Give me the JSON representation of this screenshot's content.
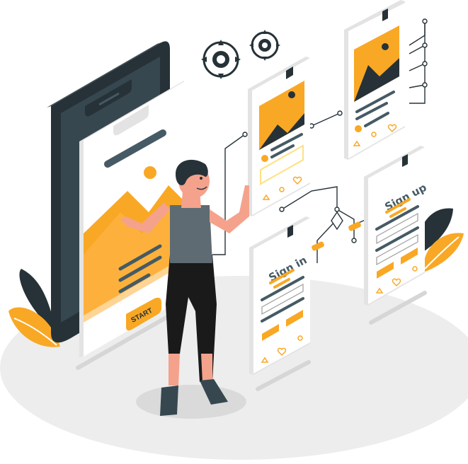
{
  "illustration": {
    "big_phone": {
      "start_label": "START"
    },
    "sign_in_screen": {
      "title": "Sign in"
    },
    "sign_up_screen": {
      "title": "Sign up"
    }
  },
  "colors": {
    "accent": "#F9A825",
    "accent_light": "#FFD54F",
    "dark": "#263238",
    "grey": "#455A64",
    "shadow": "#E8E8E8",
    "card": "#FFFFFF",
    "card_side": "#E3E3E3"
  }
}
